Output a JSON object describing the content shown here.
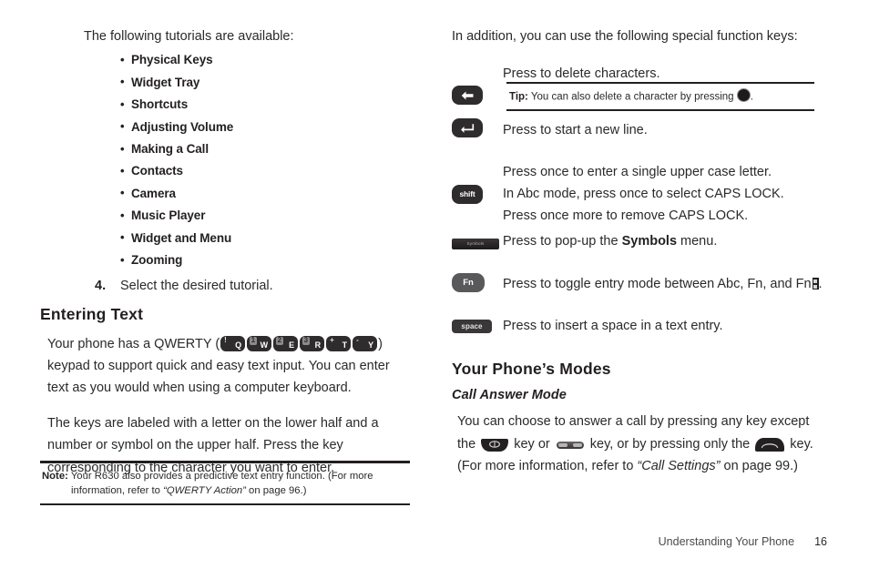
{
  "left_column": {
    "intro": "The following tutorials are available:",
    "tutorials": [
      "Physical Keys",
      "Widget Tray",
      "Shortcuts",
      "Adjusting Volume",
      "Making a Call",
      "Contacts",
      "Camera",
      "Music Player",
      "Widget and Menu",
      "Zooming"
    ],
    "step": {
      "number": "4.",
      "text": "Select the desired tutorial."
    },
    "heading": "Entering Text",
    "qwerty_para": {
      "before_keys": "Your phone has a QWERTY (",
      "after_keys": ")",
      "continuation": "keypad to support quick and easy text input. You can enter text as you would when using a computer keyboard.",
      "keys": [
        {
          "upper": "!",
          "lower": "Q",
          "boxed": false
        },
        {
          "upper": "1",
          "lower": "W",
          "boxed": true
        },
        {
          "upper": "2",
          "lower": "E",
          "boxed": true
        },
        {
          "upper": "3",
          "lower": "R",
          "boxed": true
        },
        {
          "upper": "+",
          "lower": "T",
          "boxed": false
        },
        {
          "upper": "-",
          "lower": "Y",
          "boxed": false
        }
      ]
    },
    "labels_para": "The keys are labeled with a letter on the lower half and a number or symbol on the upper half. Press the key corresponding to the character you want to enter.",
    "note": {
      "label": "Note:",
      "line1": "Your R630 also provides a predictive text entry function. (For more",
      "line2_pre": "information, refer to  ",
      "line2_italic": "“QWERTY Action”",
      "line2_post": "  on page 96.)"
    }
  },
  "right_column": {
    "intro": "In addition, you can use the following special function keys:",
    "function_keys": [
      {
        "icon": "backspace-key",
        "icon_label": "",
        "lines": [
          "Press to delete characters."
        ]
      },
      {
        "icon": "enter-key",
        "icon_label": "",
        "lines": [
          "Press to start a new line."
        ]
      },
      {
        "icon": "shift-key",
        "icon_label": "shift",
        "lines": [
          "Press once to enter a single upper case letter.",
          "In Abc mode, press once to select CAPS LOCK.",
          "Press once more to remove CAPS LOCK."
        ]
      },
      {
        "icon": "symbols-key",
        "icon_label": "Symbols",
        "lines": []
      },
      {
        "icon": "fn-key",
        "icon_label": "Fn",
        "lines": []
      },
      {
        "icon": "space-key",
        "icon_label": "space",
        "lines": [
          "Press to insert a space in a text entry."
        ]
      }
    ],
    "symbols_text": {
      "pre": "Press to pop-up the ",
      "bold": "Symbols",
      "post": " menu."
    },
    "fn_text": {
      "pre": "Press to toggle entry mode between Abc, Fn, and Fn",
      "post": "."
    },
    "tip": {
      "label": "Tip:",
      "pre": "You can also delete a character by pressing ",
      "post": "."
    },
    "modes_heading": "Your Phone’s Modes",
    "call_answer_heading": "Call Answer Mode",
    "call_answer_para": {
      "p1": "You can choose to answer a call by pressing any key except the",
      "p2": " key or ",
      "p3": " key, or by pressing only the ",
      "p4": " key. (For more information, refer to ",
      "italic": "“Call Settings”",
      "p5": " on page 99.)"
    }
  },
  "footer": {
    "chapter": "Understanding Your Phone",
    "page": "16"
  },
  "colors": {
    "text": "#2a2a2c",
    "heading": "#231f20",
    "key_dark": "#2f2c2e",
    "key_gray": "#59585a",
    "rule": "#231f20"
  }
}
